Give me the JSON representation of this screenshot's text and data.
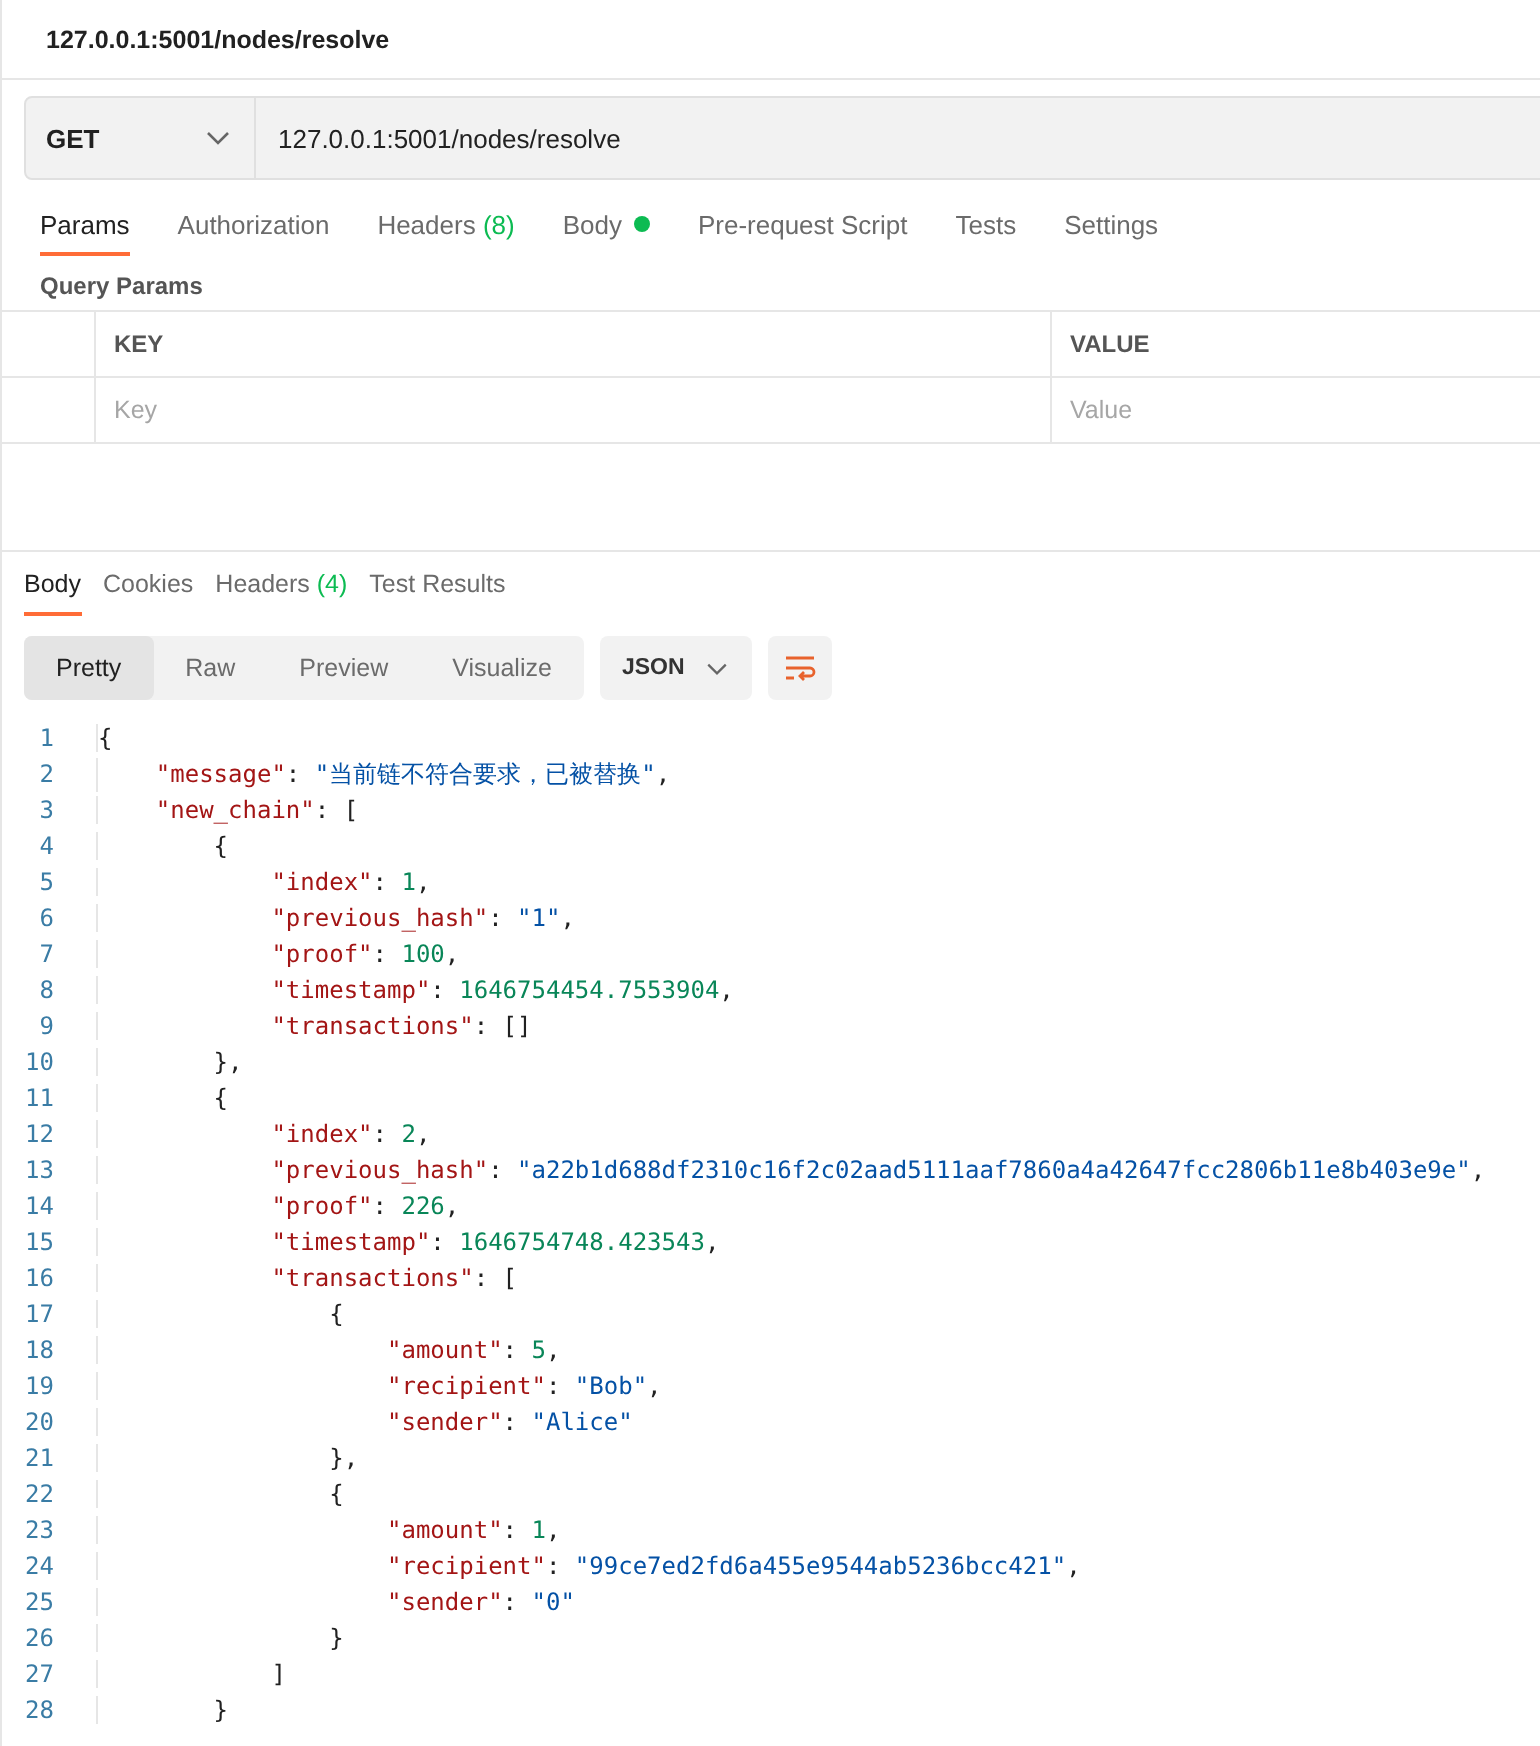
{
  "request_title": "127.0.0.1:5001/nodes/resolve",
  "method": "GET",
  "url": "127.0.0.1:5001/nodes/resolve",
  "request_tabs": [
    {
      "label": "Params",
      "selected": true
    },
    {
      "label": "Authorization",
      "selected": false
    },
    {
      "label": "Headers",
      "count": "(8)",
      "selected": false
    },
    {
      "label": "Body",
      "dot": true,
      "selected": false
    },
    {
      "label": "Pre-request Script",
      "selected": false
    },
    {
      "label": "Tests",
      "selected": false
    },
    {
      "label": "Settings",
      "selected": false
    }
  ],
  "section_title": "Query Params",
  "params_table": {
    "columns": [
      "KEY",
      "VALUE"
    ],
    "placeholders": [
      "Key",
      "Value"
    ]
  },
  "response_tabs": [
    {
      "label": "Body",
      "selected": true
    },
    {
      "label": "Cookies",
      "selected": false
    },
    {
      "label": "Headers",
      "count": "(4)",
      "selected": false
    },
    {
      "label": "Test Results",
      "selected": false
    }
  ],
  "view_modes": [
    {
      "label": "Pretty",
      "selected": true
    },
    {
      "label": "Raw",
      "selected": false
    },
    {
      "label": "Preview",
      "selected": false
    },
    {
      "label": "Visualize",
      "selected": false
    }
  ],
  "format": "JSON",
  "code_lines": [
    {
      "number": "1",
      "tokens": [
        {
          "kind": "punct",
          "text": "{"
        }
      ]
    },
    {
      "number": "2",
      "tokens": [
        {
          "kind": "key",
          "text": "    \"message\""
        },
        {
          "kind": "punct",
          "text": ": "
        },
        {
          "kind": "string",
          "text": "\"当前链不符合要求，已被替换\""
        },
        {
          "kind": "punct",
          "text": ","
        }
      ]
    },
    {
      "number": "3",
      "tokens": [
        {
          "kind": "key",
          "text": "    \"new_chain\""
        },
        {
          "kind": "punct",
          "text": ": ["
        }
      ]
    },
    {
      "number": "4",
      "tokens": [
        {
          "kind": "punct",
          "text": "        {"
        }
      ]
    },
    {
      "number": "5",
      "tokens": [
        {
          "kind": "key",
          "text": "            \"index\""
        },
        {
          "kind": "punct",
          "text": ": "
        },
        {
          "kind": "number",
          "text": "1"
        },
        {
          "kind": "punct",
          "text": ","
        }
      ]
    },
    {
      "number": "6",
      "tokens": [
        {
          "kind": "key",
          "text": "            \"previous_hash\""
        },
        {
          "kind": "punct",
          "text": ": "
        },
        {
          "kind": "string",
          "text": "\"1\""
        },
        {
          "kind": "punct",
          "text": ","
        }
      ]
    },
    {
      "number": "7",
      "tokens": [
        {
          "kind": "key",
          "text": "            \"proof\""
        },
        {
          "kind": "punct",
          "text": ": "
        },
        {
          "kind": "number",
          "text": "100"
        },
        {
          "kind": "punct",
          "text": ","
        }
      ]
    },
    {
      "number": "8",
      "tokens": [
        {
          "kind": "key",
          "text": "            \"timestamp\""
        },
        {
          "kind": "punct",
          "text": ": "
        },
        {
          "kind": "number",
          "text": "1646754454.7553904"
        },
        {
          "kind": "punct",
          "text": ","
        }
      ]
    },
    {
      "number": "9",
      "tokens": [
        {
          "kind": "key",
          "text": "            \"transactions\""
        },
        {
          "kind": "punct",
          "text": ": []"
        }
      ]
    },
    {
      "number": "10",
      "tokens": [
        {
          "kind": "punct",
          "text": "        },"
        }
      ]
    },
    {
      "number": "11",
      "tokens": [
        {
          "kind": "punct",
          "text": "        {"
        }
      ]
    },
    {
      "number": "12",
      "tokens": [
        {
          "kind": "key",
          "text": "            \"index\""
        },
        {
          "kind": "punct",
          "text": ": "
        },
        {
          "kind": "number",
          "text": "2"
        },
        {
          "kind": "punct",
          "text": ","
        }
      ]
    },
    {
      "number": "13",
      "tokens": [
        {
          "kind": "key",
          "text": "            \"previous_hash\""
        },
        {
          "kind": "punct",
          "text": ": "
        },
        {
          "kind": "string",
          "text": "\"a22b1d688df2310c16f2c02aad5111aaf7860a4a42647fcc2806b11e8b403e9e\""
        },
        {
          "kind": "punct",
          "text": ","
        }
      ]
    },
    {
      "number": "14",
      "tokens": [
        {
          "kind": "key",
          "text": "            \"proof\""
        },
        {
          "kind": "punct",
          "text": ": "
        },
        {
          "kind": "number",
          "text": "226"
        },
        {
          "kind": "punct",
          "text": ","
        }
      ]
    },
    {
      "number": "15",
      "tokens": [
        {
          "kind": "key",
          "text": "            \"timestamp\""
        },
        {
          "kind": "punct",
          "text": ": "
        },
        {
          "kind": "number",
          "text": "1646754748.423543"
        },
        {
          "kind": "punct",
          "text": ","
        }
      ]
    },
    {
      "number": "16",
      "tokens": [
        {
          "kind": "key",
          "text": "            \"transactions\""
        },
        {
          "kind": "punct",
          "text": ": ["
        }
      ]
    },
    {
      "number": "17",
      "tokens": [
        {
          "kind": "punct",
          "text": "                {"
        }
      ]
    },
    {
      "number": "18",
      "tokens": [
        {
          "kind": "key",
          "text": "                    \"amount\""
        },
        {
          "kind": "punct",
          "text": ": "
        },
        {
          "kind": "number",
          "text": "5"
        },
        {
          "kind": "punct",
          "text": ","
        }
      ]
    },
    {
      "number": "19",
      "tokens": [
        {
          "kind": "key",
          "text": "                    \"recipient\""
        },
        {
          "kind": "punct",
          "text": ": "
        },
        {
          "kind": "string",
          "text": "\"Bob\""
        },
        {
          "kind": "punct",
          "text": ","
        }
      ]
    },
    {
      "number": "20",
      "tokens": [
        {
          "kind": "key",
          "text": "                    \"sender\""
        },
        {
          "kind": "punct",
          "text": ": "
        },
        {
          "kind": "string",
          "text": "\"Alice\""
        }
      ]
    },
    {
      "number": "21",
      "tokens": [
        {
          "kind": "punct",
          "text": "                },"
        }
      ]
    },
    {
      "number": "22",
      "tokens": [
        {
          "kind": "punct",
          "text": "                {"
        }
      ]
    },
    {
      "number": "23",
      "tokens": [
        {
          "kind": "key",
          "text": "                    \"amount\""
        },
        {
          "kind": "punct",
          "text": ": "
        },
        {
          "kind": "number",
          "text": "1"
        },
        {
          "kind": "punct",
          "text": ","
        }
      ]
    },
    {
      "number": "24",
      "tokens": [
        {
          "kind": "key",
          "text": "                    \"recipient\""
        },
        {
          "kind": "punct",
          "text": ": "
        },
        {
          "kind": "string",
          "text": "\"99ce7ed2fd6a455e9544ab5236bcc421\""
        },
        {
          "kind": "punct",
          "text": ","
        }
      ]
    },
    {
      "number": "25",
      "tokens": [
        {
          "kind": "key",
          "text": "                    \"sender\""
        },
        {
          "kind": "punct",
          "text": ": "
        },
        {
          "kind": "string",
          "text": "\"0\""
        }
      ]
    },
    {
      "number": "26",
      "tokens": [
        {
          "kind": "punct",
          "text": "                }"
        }
      ]
    },
    {
      "number": "27",
      "tokens": [
        {
          "kind": "punct",
          "text": "            ]"
        }
      ]
    },
    {
      "number": "28",
      "tokens": [
        {
          "kind": "punct",
          "text": "        }"
        }
      ]
    }
  ]
}
